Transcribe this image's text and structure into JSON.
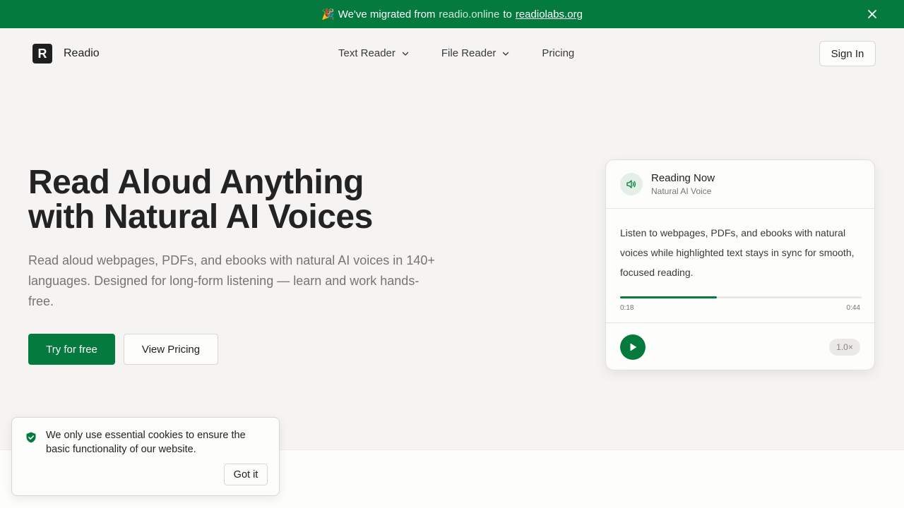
{
  "banner": {
    "emoji": "🎉",
    "prefix": "We've migrated from",
    "old_domain": "readio.online",
    "connector": "to",
    "new_domain": "readiolabs.org",
    "close_icon": "close-icon"
  },
  "header": {
    "logo_letter": "R",
    "brand": "Readio",
    "nav": [
      {
        "label": "Text Reader",
        "icon": "chevron-down-icon"
      },
      {
        "label": "File Reader",
        "icon": "chevron-down-icon"
      },
      {
        "label": "Pricing"
      }
    ],
    "signin_label": "Sign In"
  },
  "hero": {
    "title_line1": "Read Aloud Anything",
    "title_line2": "with Natural AI Voices",
    "subtitle": "Read aloud webpages, PDFs, and ebooks with natural AI voices in 140+ languages. Designed for long-form listening — learn and work hands-free.",
    "primary_cta": "Try for free",
    "secondary_cta": "View Pricing"
  },
  "player": {
    "title": "Reading Now",
    "subtitle": "Natural AI Voice",
    "text": "Listen to webpages, PDFs, and ebooks with natural voices while highlighted text stays in sync for smooth, focused reading.",
    "progress": 0.4,
    "time_elapsed": "0:18",
    "time_total": "0:44",
    "speed": "1.0×",
    "speaker_icon": "speaker-icon",
    "play_icon": "play-icon"
  },
  "cookie": {
    "text": "We only use essential cookies to ensure the basic functionality of our website.",
    "button": "Got it",
    "icon": "shield-check-icon"
  },
  "colors": {
    "brand_green": "#047a3e",
    "page_bg": "#f5f4f2"
  }
}
